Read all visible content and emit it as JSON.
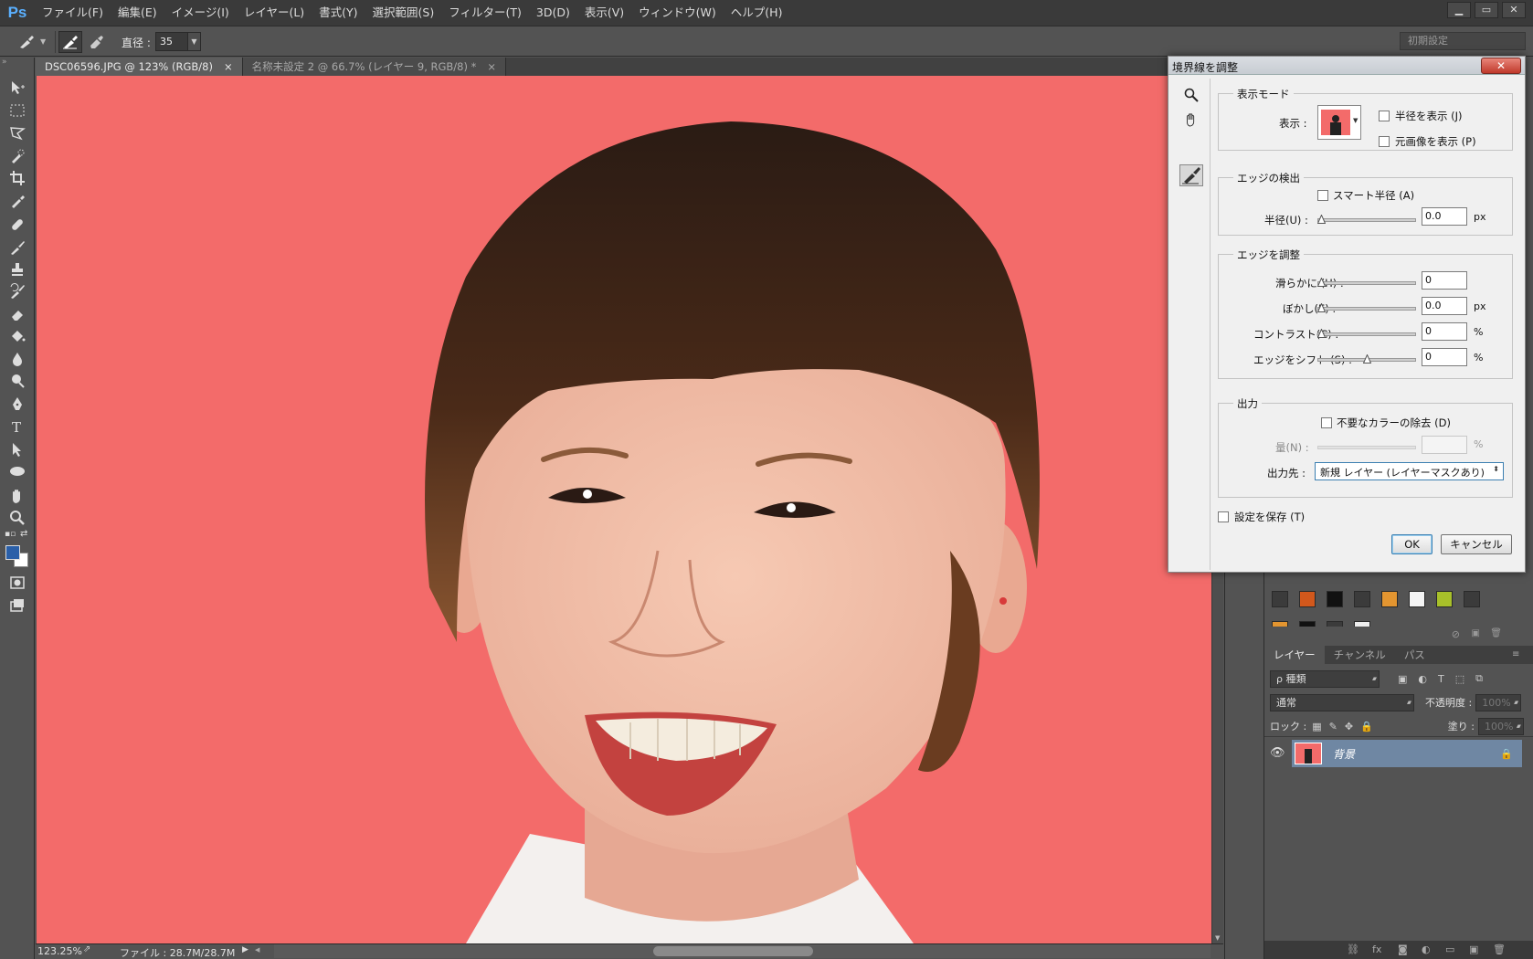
{
  "app": {
    "logo": "Ps",
    "menu": [
      "ファイル(F)",
      "編集(E)",
      "イメージ(I)",
      "レイヤー(L)",
      "書式(Y)",
      "選択範囲(S)",
      "フィルター(T)",
      "3D(D)",
      "表示(V)",
      "ウィンドウ(W)",
      "ヘルプ(H)"
    ],
    "window_controls": [
      "▁",
      "▭",
      "✕"
    ]
  },
  "options": {
    "diameter_label": "直径 :",
    "diameter_value": "35",
    "workspace": "初期設定"
  },
  "tabs": [
    {
      "label": "DSC06596.JPG @ 123% (RGB/8)",
      "close": "×",
      "active": true
    },
    {
      "label": "名称未設定 2 @ 66.7% (レイヤー 9, RGB/8) *",
      "close": "×",
      "active": false
    }
  ],
  "status": {
    "zoom": "123.25%",
    "file": "ファイル : 28.7M/28.7M"
  },
  "colors": {
    "canvas_bg": "#f36b6a",
    "foreground": "#2a5fa8",
    "background": "#ffffff",
    "selected_layer": "#6f87a3"
  },
  "dialog": {
    "title": "境界線を調整",
    "close": "✕",
    "view_mode": {
      "title": "表示モード",
      "view_label": "表示 :",
      "show_radius": "半径を表示 (J)",
      "show_original": "元画像を表示 (P)"
    },
    "edge_detection": {
      "title": "エッジの検出",
      "smart_radius": "スマート半径 (A)",
      "radius_label": "半径(U) :",
      "radius_value": "0.0",
      "radius_unit": "px"
    },
    "adjust_edge": {
      "title": "エッジを調整",
      "rows": [
        {
          "label": "滑らかに (H) :",
          "value": "0",
          "unit": "",
          "level": 0
        },
        {
          "label": "ぼかし(E) :",
          "value": "0.0",
          "unit": "px",
          "level": 0
        },
        {
          "label": "コントラスト(C) :",
          "value": "0",
          "unit": "%",
          "level": 0
        },
        {
          "label": "エッジをシフト (S) :",
          "value": "0",
          "unit": "%",
          "level": 0.5
        }
      ]
    },
    "output": {
      "title": "出力",
      "decontaminate": "不要なカラーの除去 (D)",
      "amount_label": "量(N) :",
      "amount_unit": "%",
      "output_to_label": "出力先 :",
      "output_to_value": "新規 レイヤー (レイヤーマスクあり)"
    },
    "remember": "設定を保存 (T)",
    "ok": "OK",
    "cancel": "キャンセル"
  },
  "layers_panel": {
    "tabs": [
      "レイヤー",
      "チャンネル",
      "パス"
    ],
    "filter_kind": "ρ 種類",
    "blend_mode": "通常",
    "opacity_label": "不透明度 :",
    "opacity_value": "100%",
    "lock_label": "ロック :",
    "fill_label": "塗り :",
    "fill_value": "100%",
    "layers": [
      {
        "name": "背景",
        "locked": true,
        "visible": true
      }
    ]
  },
  "swatches": {
    "row1": [
      "#3b3b3b",
      "#d2581c",
      "#111111",
      "#3b3b3b",
      "#e39530",
      "#f5f5f5",
      "#a8c02a",
      "#3b3b3b"
    ]
  }
}
